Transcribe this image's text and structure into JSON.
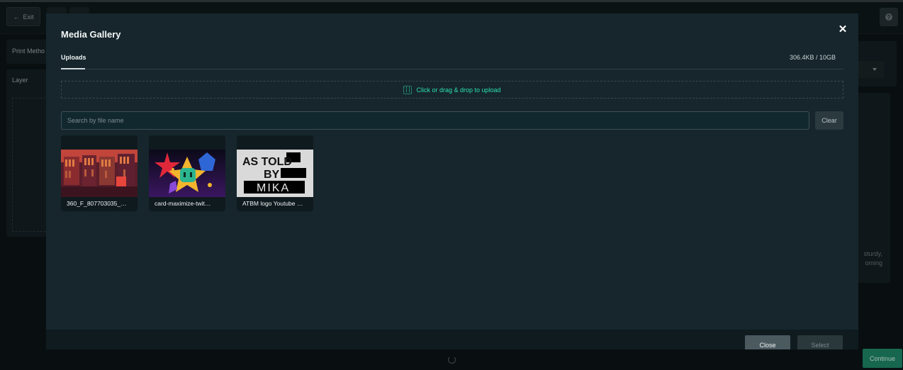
{
  "background": {
    "exit_label": "Exit",
    "print_method_label": "Print Metho",
    "layer_label": "Layer",
    "right_text_line1": "sturdy,",
    "right_text_line2": "oming",
    "continue_label": "Continue"
  },
  "modal": {
    "title": "Media Gallery",
    "close_icon": "close-icon",
    "tabs": [
      {
        "label": "Uploads",
        "active": true
      }
    ],
    "storage": "306.4KB / 10GB",
    "dropzone_text": "Click or drag & drop to upload",
    "search": {
      "placeholder": "Search by file name",
      "value": ""
    },
    "clear_label": "Clear",
    "files": [
      {
        "name": "360_F_807703035_…"
      },
      {
        "name": "card-maximize-twit…"
      },
      {
        "name": "ATBM logo Youtube …",
        "thumb_text": {
          "line1": "AS TOLD",
          "line2": "BY",
          "line3": "MIKA"
        }
      }
    ],
    "footer": {
      "close_label": "Close",
      "select_label": "Select"
    }
  },
  "colors": {
    "accent": "#2de0b4",
    "continue": "#1f8f6b",
    "modal_bg": "#16262c"
  }
}
